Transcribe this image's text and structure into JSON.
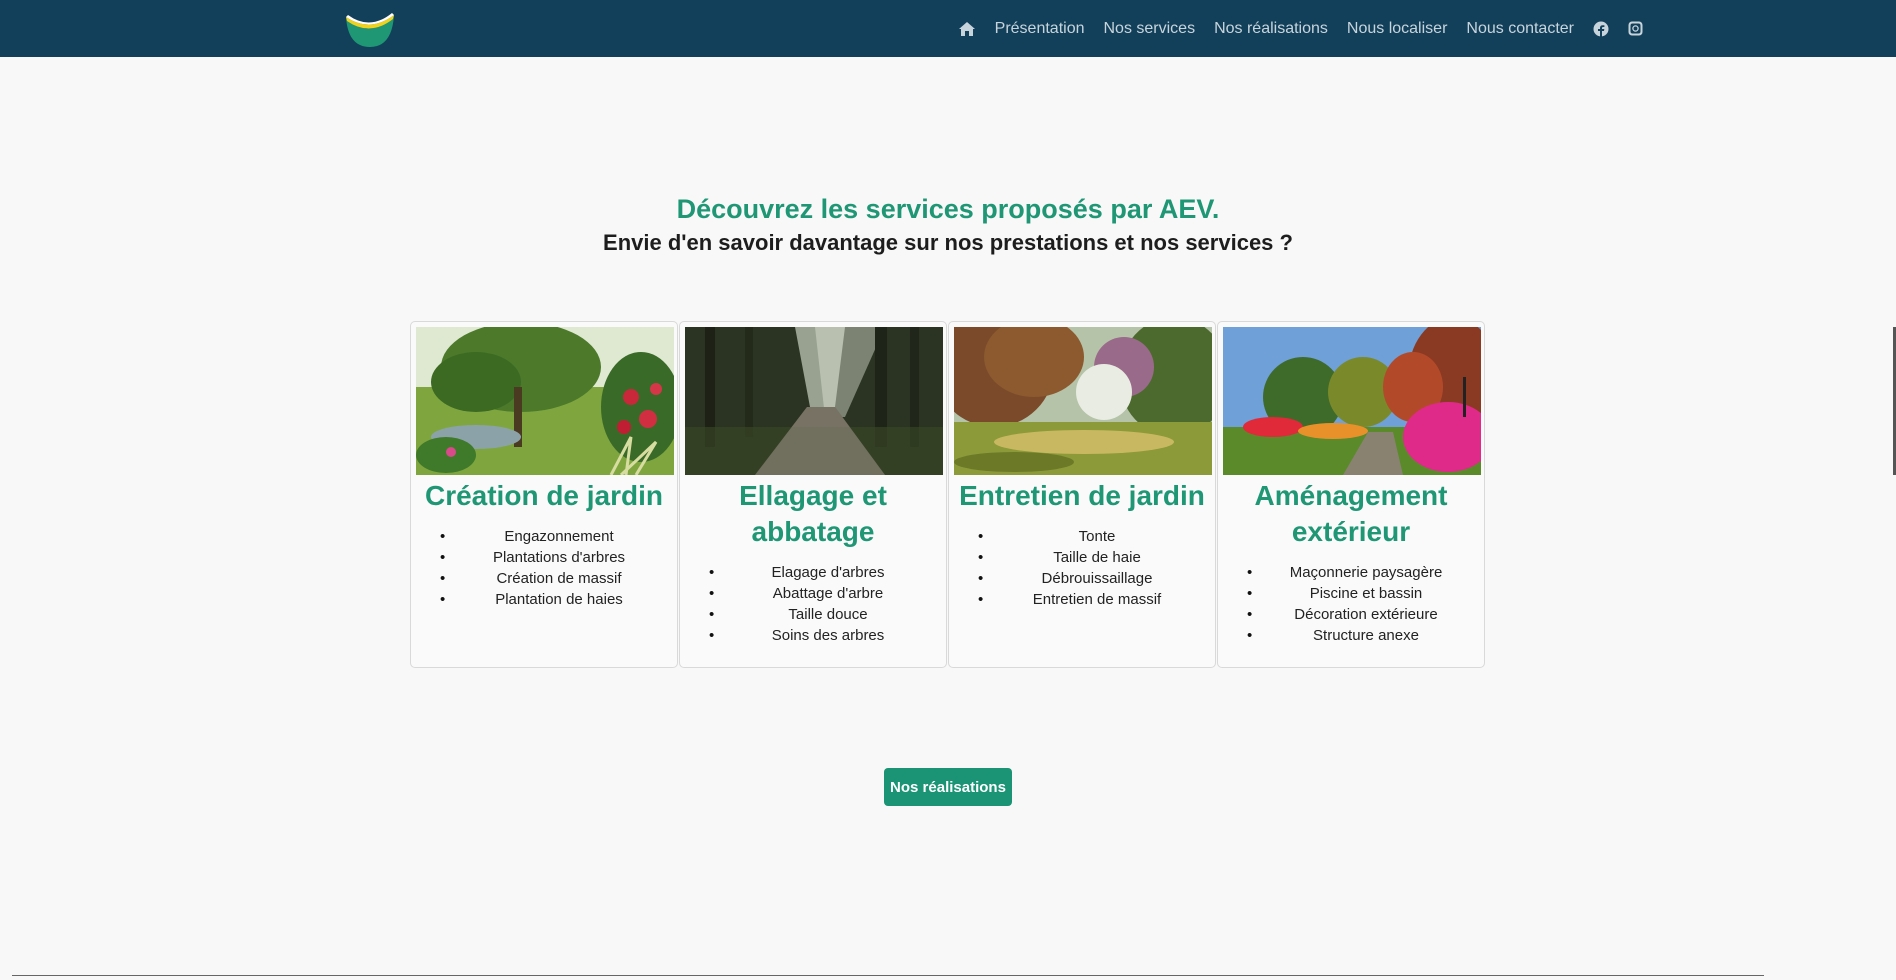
{
  "header": {
    "logo": "aev-logo",
    "icons": {
      "home": "home-icon",
      "facebook": "facebook-icon",
      "instagram": "instagram-icon"
    },
    "nav": [
      "Présentation",
      "Nos services",
      "Nos réalisations",
      "Nous localiser",
      "Nous contacter"
    ]
  },
  "hero": {
    "title": "Découvrez les services proposés par AEV.",
    "subtitle": "Envie d'en savoir davantage sur nos prestations et nos services ?"
  },
  "cards": [
    {
      "title": "Création de jardin",
      "image": "garden-pond-photo",
      "items": [
        "Engazonnement",
        "Plantations d'arbres",
        "Création de massif",
        "Plantation de haies"
      ]
    },
    {
      "title": "Ellagage et abbatage",
      "image": "forest-path-photo",
      "items": [
        "Elagage d'arbres",
        "Abattage d'arbre",
        "Taille douce",
        "Soins des arbres"
      ]
    },
    {
      "title": "Entretien de jardin",
      "image": "park-lawn-photo",
      "items": [
        "Tonte",
        "Taille de haie",
        "Débrouissaillage",
        "Entretien de massif"
      ]
    },
    {
      "title": "Aménagement extérieur",
      "image": "flower-garden-photo",
      "items": [
        "Maçonnerie paysagère",
        "Piscine et bassin",
        "Décoration extérieure",
        "Structure anexe"
      ]
    }
  ],
  "cta": {
    "label": "Nos réalisations"
  },
  "colors": {
    "navbar": "#12405a",
    "accent": "#1f9775",
    "button": "#1a9474"
  }
}
